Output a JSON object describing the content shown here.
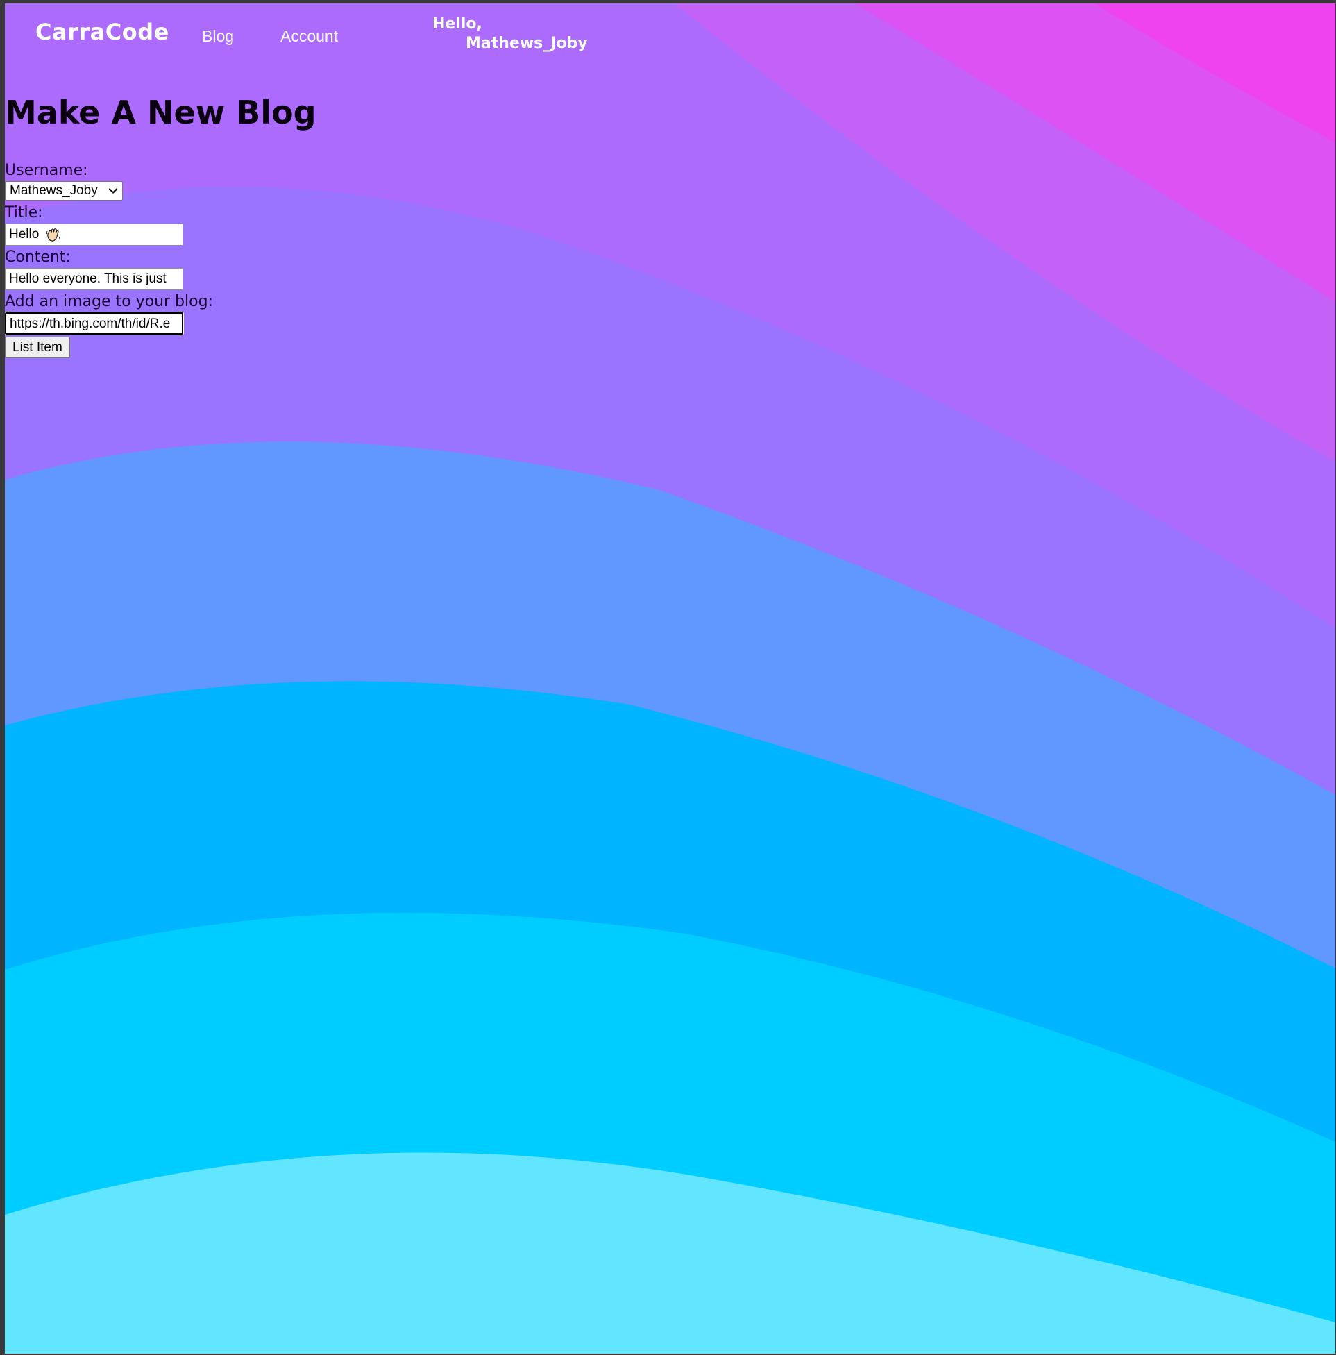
{
  "nav": {
    "brand": "CarraCode",
    "links": [
      "Blog",
      "Account"
    ],
    "greeting": "Hello,",
    "username": "Mathews_Joby"
  },
  "page": {
    "title": "Make A New Blog"
  },
  "form": {
    "username_label": "Username:",
    "username_value": "Mathews_Joby",
    "title_label": "Title:",
    "title_value": "Hello",
    "content_label": "Content:",
    "content_value": "Hello everyone. This is just",
    "image_label": "Add an image to your blog:",
    "image_value": "https://th.bing.com/th/id/R.e",
    "submit_label": "List Item"
  },
  "icons": {
    "title_emoji": "waving-hand-icon",
    "select_arrow": "chevron-down-icon"
  },
  "colors": {
    "band_magenta": "#ef43f0",
    "band_pink": "#dc52f2",
    "band_violet": "#c462f8",
    "band_purple": "#ad6bfe",
    "band_lavender": "#9a73ff",
    "band_periwinkle": "#6198ff",
    "band_azure": "#00b4ff",
    "band_sky": "#00cdff",
    "band_aqua": "#62e5ff"
  }
}
